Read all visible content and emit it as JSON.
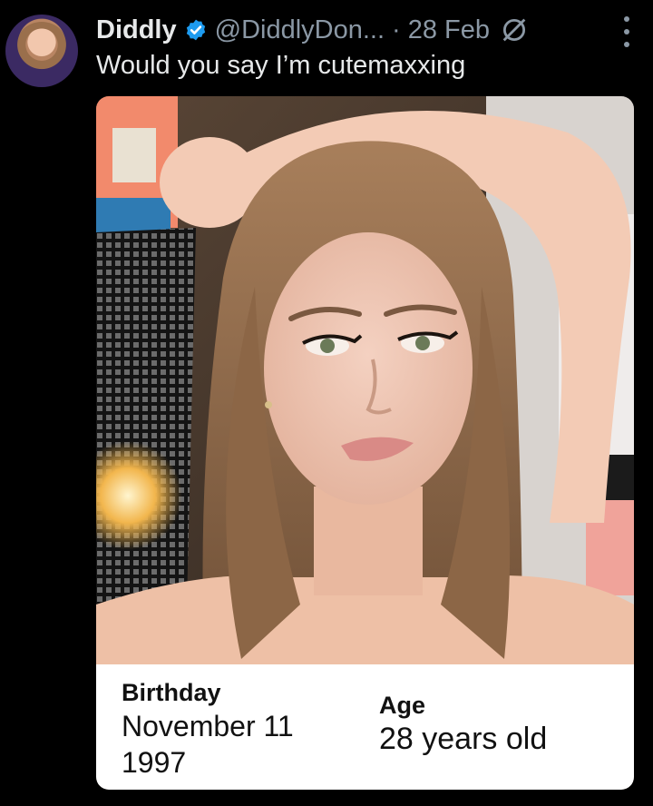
{
  "post": {
    "display_name": "Diddly",
    "handle": "@DiddlyDon...",
    "date": "· 28 Feb",
    "text": "Would you say I’m cutemaxxing",
    "icons": [
      "verified-badge-icon",
      "grok-icon",
      "more-options-icon"
    ],
    "colors": {
      "verified": "#1d9bf0",
      "muted_text": "#8b98a5"
    }
  },
  "info_card": {
    "birthday_label": "Birthday",
    "birthday_date": "November 11",
    "birthday_year": "1997",
    "age_label": "Age",
    "age_value": "28 years old"
  }
}
